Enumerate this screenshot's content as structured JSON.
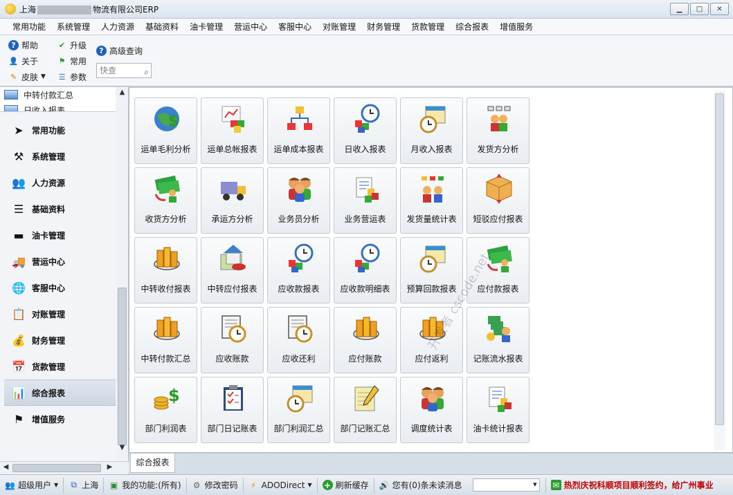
{
  "window": {
    "title_prefix": "上海",
    "title_suffix": "物流有限公司ERP",
    "controls": [
      "minimize",
      "maximize",
      "close"
    ]
  },
  "menu": [
    "常用功能",
    "系统管理",
    "人力资源",
    "基础资料",
    "油卡管理",
    "营运中心",
    "客服中心",
    "对账管理",
    "财务管理",
    "货款管理",
    "综合报表",
    "增值服务"
  ],
  "toolbar": {
    "help": "帮助",
    "upgrade": "升级",
    "advanced_search": "高级查询",
    "about": "关于",
    "common": "常用",
    "skin": "皮肤",
    "params": "参数",
    "quick_placeholder": "快查"
  },
  "sidebar": {
    "top_items": [
      "中转付款汇总",
      "日收入报表"
    ],
    "nav": [
      {
        "label": "常用功能",
        "icon": "cursor-icon"
      },
      {
        "label": "系统管理",
        "icon": "tools-icon"
      },
      {
        "label": "人力资源",
        "icon": "people-icon"
      },
      {
        "label": "基础资料",
        "icon": "list-icon"
      },
      {
        "label": "油卡管理",
        "icon": "card-icon"
      },
      {
        "label": "营运中心",
        "icon": "truck-icon"
      },
      {
        "label": "客服中心",
        "icon": "globe-icon"
      },
      {
        "label": "对账管理",
        "icon": "checklist-icon"
      },
      {
        "label": "财务管理",
        "icon": "coins-icon"
      },
      {
        "label": "货款管理",
        "icon": "calendar-icon"
      },
      {
        "label": "综合报表",
        "icon": "report-icon"
      },
      {
        "label": "增值服务",
        "icon": "flag-icon"
      }
    ],
    "active_index": 10
  },
  "reports": [
    {
      "label": "运单毛利分析",
      "icon": "globe-dollar-icon"
    },
    {
      "label": "运单总帐报表",
      "icon": "chart-blocks-icon"
    },
    {
      "label": "运单成本报表",
      "icon": "hierarchy-icon"
    },
    {
      "label": "日收入报表",
      "icon": "clock-blocks-icon"
    },
    {
      "label": "月收入报表",
      "icon": "calendar-clock-icon"
    },
    {
      "label": "发货方分析",
      "icon": "people-chart-icon"
    },
    {
      "label": "收货方分析",
      "icon": "money-user-icon"
    },
    {
      "label": "承运方分析",
      "icon": "truck-icon"
    },
    {
      "label": "业务员分析",
      "icon": "people-icon"
    },
    {
      "label": "业务营运表",
      "icon": "hand-chart-icon"
    },
    {
      "label": "发货量统计表",
      "icon": "people-network-icon"
    },
    {
      "label": "短驳应付报表",
      "icon": "box-icon"
    },
    {
      "label": "中转收付报表",
      "icon": "chart-bars-icon"
    },
    {
      "label": "中转应付报表",
      "icon": "map-house-icon"
    },
    {
      "label": "应收款报表",
      "icon": "clock-blocks-icon"
    },
    {
      "label": "应收款明细表",
      "icon": "clock-blocks-icon"
    },
    {
      "label": "预算回款报表",
      "icon": "calendar-clock-icon"
    },
    {
      "label": "应付款报表",
      "icon": "money-user-icon"
    },
    {
      "label": "中转付款汇总",
      "icon": "chart-bars-icon"
    },
    {
      "label": "应收账款",
      "icon": "doc-clock-icon"
    },
    {
      "label": "应收还利",
      "icon": "doc-clock-icon"
    },
    {
      "label": "应付账款",
      "icon": "chart-bars-icon"
    },
    {
      "label": "应付返利",
      "icon": "chart-bars-icon"
    },
    {
      "label": "记账流水报表",
      "icon": "pi-user-icon"
    },
    {
      "label": "部门利润表",
      "icon": "coins-dollar-icon"
    },
    {
      "label": "部门日记账表",
      "icon": "clipboard-icon"
    },
    {
      "label": "部门利润汇总",
      "icon": "calendar-clock-icon"
    },
    {
      "label": "部门记账汇总",
      "icon": "notepad-icon"
    },
    {
      "label": "调度统计表",
      "icon": "people-icon"
    },
    {
      "label": "油卡统计报表",
      "icon": "hand-chart-icon"
    }
  ],
  "tab": "综合报表",
  "watermark": "开发者 cscode.net",
  "status": {
    "user": "超级用户",
    "city": "上海",
    "my_functions": "我的功能:(所有)",
    "change_password": "修改密码",
    "db": "ADODirect",
    "refresh": "刷新缓存",
    "messages": "您有(0)条未读消息",
    "news": "热烈庆祝科顺项目顺利签约，给广州事业",
    "colors": {
      "news": "#c00000"
    }
  }
}
